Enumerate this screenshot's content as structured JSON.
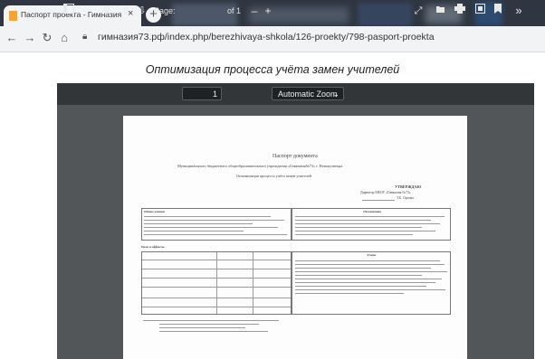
{
  "browser": {
    "tab_title": "Паспорт проекта - Гимназия №",
    "tab_close": "×",
    "new_tab": "+",
    "url": "гимназия73.рф/index.php/berezhivaya-shkola/126-proekty/798-pasport-proekta",
    "nav_icons": [
      "back-icon",
      "forward-icon",
      "reload-icon",
      "home-icon",
      "lock-icon"
    ]
  },
  "page": {
    "title": "Оптимизация процесса учёта замен учителей"
  },
  "viewer": {
    "page_label": "Page:",
    "page_number": "1",
    "page_total": "of 1",
    "zoom_minus": "–",
    "zoom_plus": "+",
    "zoom_value": "Automatic Zoom",
    "more": "»"
  },
  "document": {
    "heading": "Паспорт документа",
    "org_line": "Муниципального бюджетного общеобразовательного учреждения «Гимназия№73» г. Новокузнецка",
    "subtitle": "Оптимизация процесса учёта замен учителей",
    "approve_title": "УТВЕРЖДАЮ",
    "approve_line1": "Директор МБОУ «Гимназия №73»",
    "approve_line2": "Т.Б. Орлова",
    "sections": {
      "common": "Общие данные",
      "goals": "Обоснование",
      "effects": "Цели и эффекты",
      "stages": "Этапы"
    }
  }
}
